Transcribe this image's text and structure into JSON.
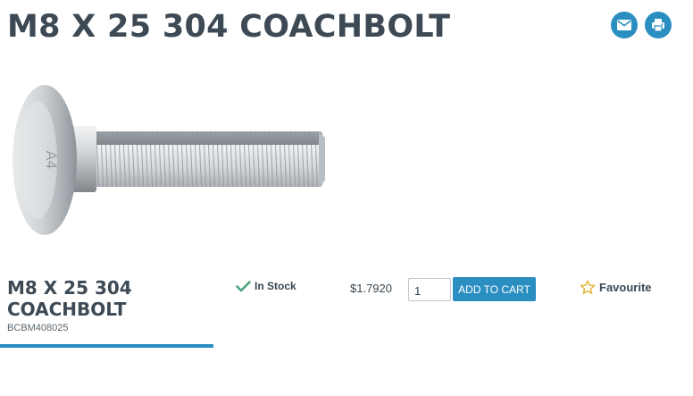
{
  "product": {
    "title": "M8 X 25 304 COACHBOLT",
    "name": "M8 X 25 304 COACHBOLT",
    "sku": "BCBM408025",
    "image_alt": "Stainless coach bolt",
    "head_marking": "A4"
  },
  "stock": {
    "label": "In Stock",
    "icon": "check-icon"
  },
  "price": {
    "value": "$1.7920"
  },
  "quantity": {
    "value": "1"
  },
  "cart": {
    "add_label": "ADD TO CART"
  },
  "favourite": {
    "label": "Favourite",
    "icon": "star-outline-icon"
  },
  "header_actions": [
    {
      "icon": "envelope-icon"
    },
    {
      "icon": "printer-icon"
    }
  ],
  "colors": {
    "accent": "#2a8ec1",
    "heading": "#3d4a55",
    "stock_check": "#4aa37a",
    "star": "#e2b53b"
  }
}
